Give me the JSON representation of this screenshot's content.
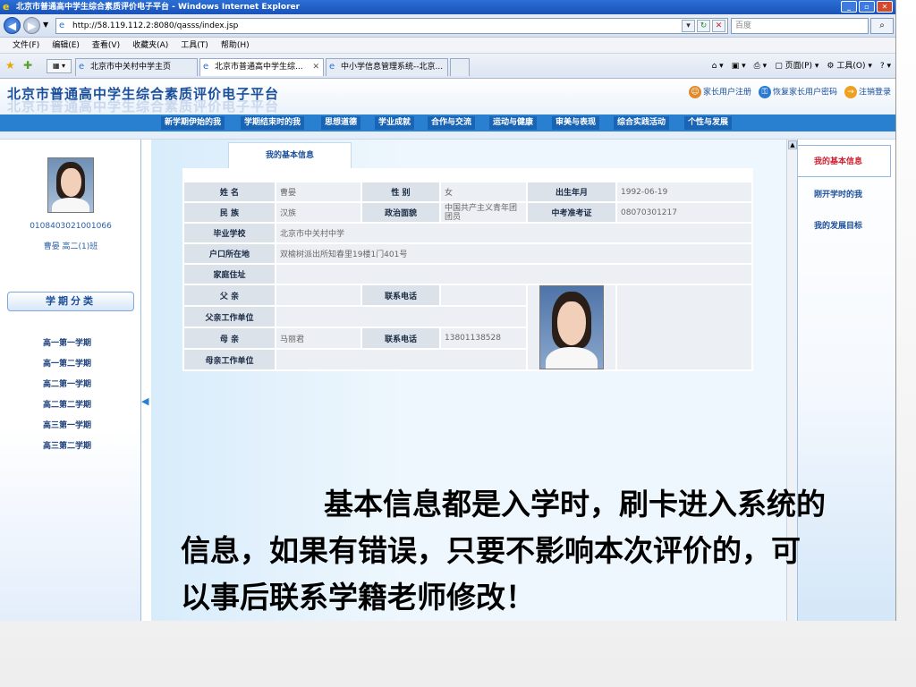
{
  "window": {
    "title": "北京市普通高中学生综合素质评价电子平台 - Windows Internet Explorer",
    "url": "http://58.119.112.2:8080/qasss/index.jsp",
    "search_placeholder": "百度"
  },
  "menu": [
    "文件(F)",
    "编辑(E)",
    "查看(V)",
    "收藏夹(A)",
    "工具(T)",
    "帮助(H)"
  ],
  "tabs": [
    {
      "label": "北京市中关村中学主页"
    },
    {
      "label": "北京市普通高中学生综..."
    },
    {
      "label": "中小学信息管理系统--北京..."
    }
  ],
  "commands": [
    "页面(P)",
    "工具(O)"
  ],
  "site": {
    "title": "北京市普通高中学生综合素质评价电子平台",
    "links": [
      "家长用户注册",
      "恢复家长用户密码",
      "注销登录"
    ]
  },
  "nav": [
    "新学期伊始的我",
    "学期结束时的我",
    "思想道德",
    "学业成就",
    "合作与交流",
    "运动与健康",
    "审美与表现",
    "综合实践活动",
    "个性与发展"
  ],
  "student": {
    "id": "0108403021001066",
    "name_class": "曹晏  高二(1)班"
  },
  "term_header": "学期分类",
  "terms": [
    "高一第一学期",
    "高一第二学期",
    "高二第一学期",
    "高二第二学期",
    "高三第一学期",
    "高三第二学期"
  ],
  "main_tab": "我的基本信息",
  "info": {
    "name_label": "姓  名",
    "name": "曹晏",
    "gender_label": "性  别",
    "gender": "女",
    "birth_label": "出生年月",
    "birth": "1992-06-19",
    "ethnic_label": "民  族",
    "ethnic": "汉族",
    "political_label": "政治面貌",
    "political": "中国共产主义青年团团员",
    "exam_label": "中考准考证",
    "exam": "08070301217",
    "school_label": "毕业学校",
    "school": "北京市中关村中学",
    "hukou_label": "户口所在地",
    "hukou": "双榆树派出所知春里19楼1门401号",
    "address_label": "家庭住址",
    "address": "",
    "father_label": "父  亲",
    "father": "",
    "father_phone_label": "联系电话",
    "father_phone": "",
    "father_work_label": "父亲工作单位",
    "father_work": "",
    "mother_label": "母  亲",
    "mother": "马丽君",
    "mother_phone_label": "联系电话",
    "mother_phone": "13801138528",
    "mother_work_label": "母亲工作单位",
    "mother_work": ""
  },
  "right_menu": [
    "我的基本信息",
    "刚开学时的我",
    "我的发展目标"
  ],
  "caption": "基本信息都是入学时，刷卡进入系统的信息，如果有错误，只要不影响本次评价的，可以事后联系学籍老师修改！"
}
